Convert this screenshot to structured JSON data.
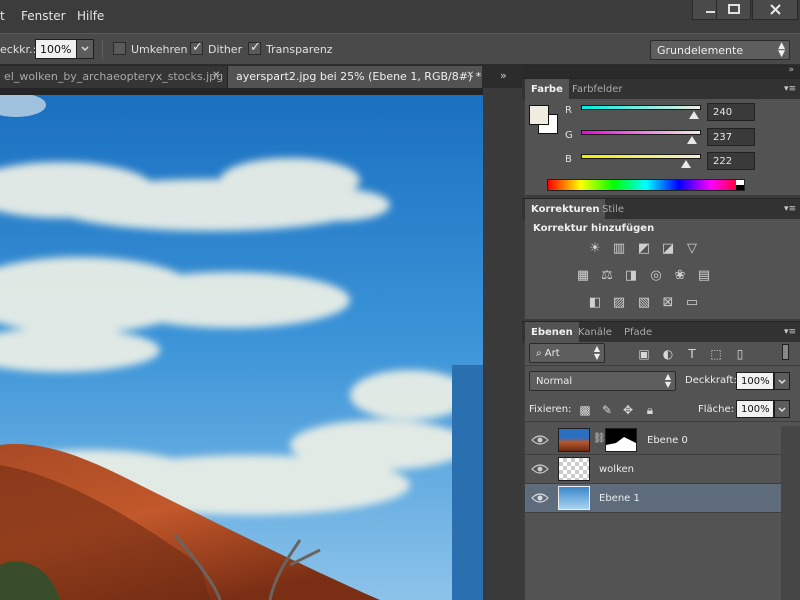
{
  "menubar": {
    "items": [
      "t",
      "Fenster",
      "Hilfe"
    ]
  },
  "options": {
    "opacity_label": "eckkr.:",
    "opacity_value": "100%",
    "reverse_label": "Umkehren",
    "reverse_checked": false,
    "dither_label": "Dither",
    "dither_checked": true,
    "transparency_label": "Transparenz",
    "transparency_checked": true,
    "workspace": "Grundelemente"
  },
  "document_tabs": [
    {
      "label": "el_wolken_by_archaeopteryx_stocks.jpg",
      "active": false
    },
    {
      "label": "ayerspart2.jpg bei 25% (Ebene 1, RGB/8#) *",
      "active": true
    }
  ],
  "color_panel": {
    "tabs": [
      "Farbe",
      "Farbfelder"
    ],
    "foreground": "#f0ede0",
    "background": "#ffffff",
    "channels": [
      {
        "label": "R",
        "value": "240",
        "level": 0.941
      },
      {
        "label": "G",
        "value": "237",
        "level": 0.929
      },
      {
        "label": "B",
        "value": "222",
        "level": 0.871
      }
    ]
  },
  "adjust_panel": {
    "tabs": [
      "Korrekturen",
      "Stile"
    ],
    "heading": "Korrektur hinzufügen",
    "icons": [
      [
        "brightness-icon",
        "levels-icon",
        "curves-icon",
        "exposure-icon",
        "vibrance-icon"
      ],
      [
        "hue-saturation-icon",
        "color-balance-icon",
        "black-white-icon",
        "photo-filter-icon",
        "channel-mixer-icon",
        "color-lookup-icon"
      ],
      [
        "invert-icon",
        "posterize-icon",
        "threshold-icon",
        "selective-color-icon",
        "gradient-map-icon"
      ]
    ]
  },
  "layers_panel": {
    "tabs": [
      "Ebenen",
      "Kanäle",
      "Pfade"
    ],
    "filter": "Art",
    "blend_mode": "Normal",
    "opacity_label": "Deckkraft:",
    "opacity_value": "100%",
    "lock_label": "Fixieren:",
    "fill_label": "Fläche:",
    "fill_value": "100%",
    "layers": [
      {
        "name": "Ebene 0",
        "selected": false,
        "masked": true
      },
      {
        "name": "wolken",
        "selected": false,
        "masked": false
      },
      {
        "name": "Ebene 1",
        "selected": true,
        "masked": false
      }
    ]
  }
}
